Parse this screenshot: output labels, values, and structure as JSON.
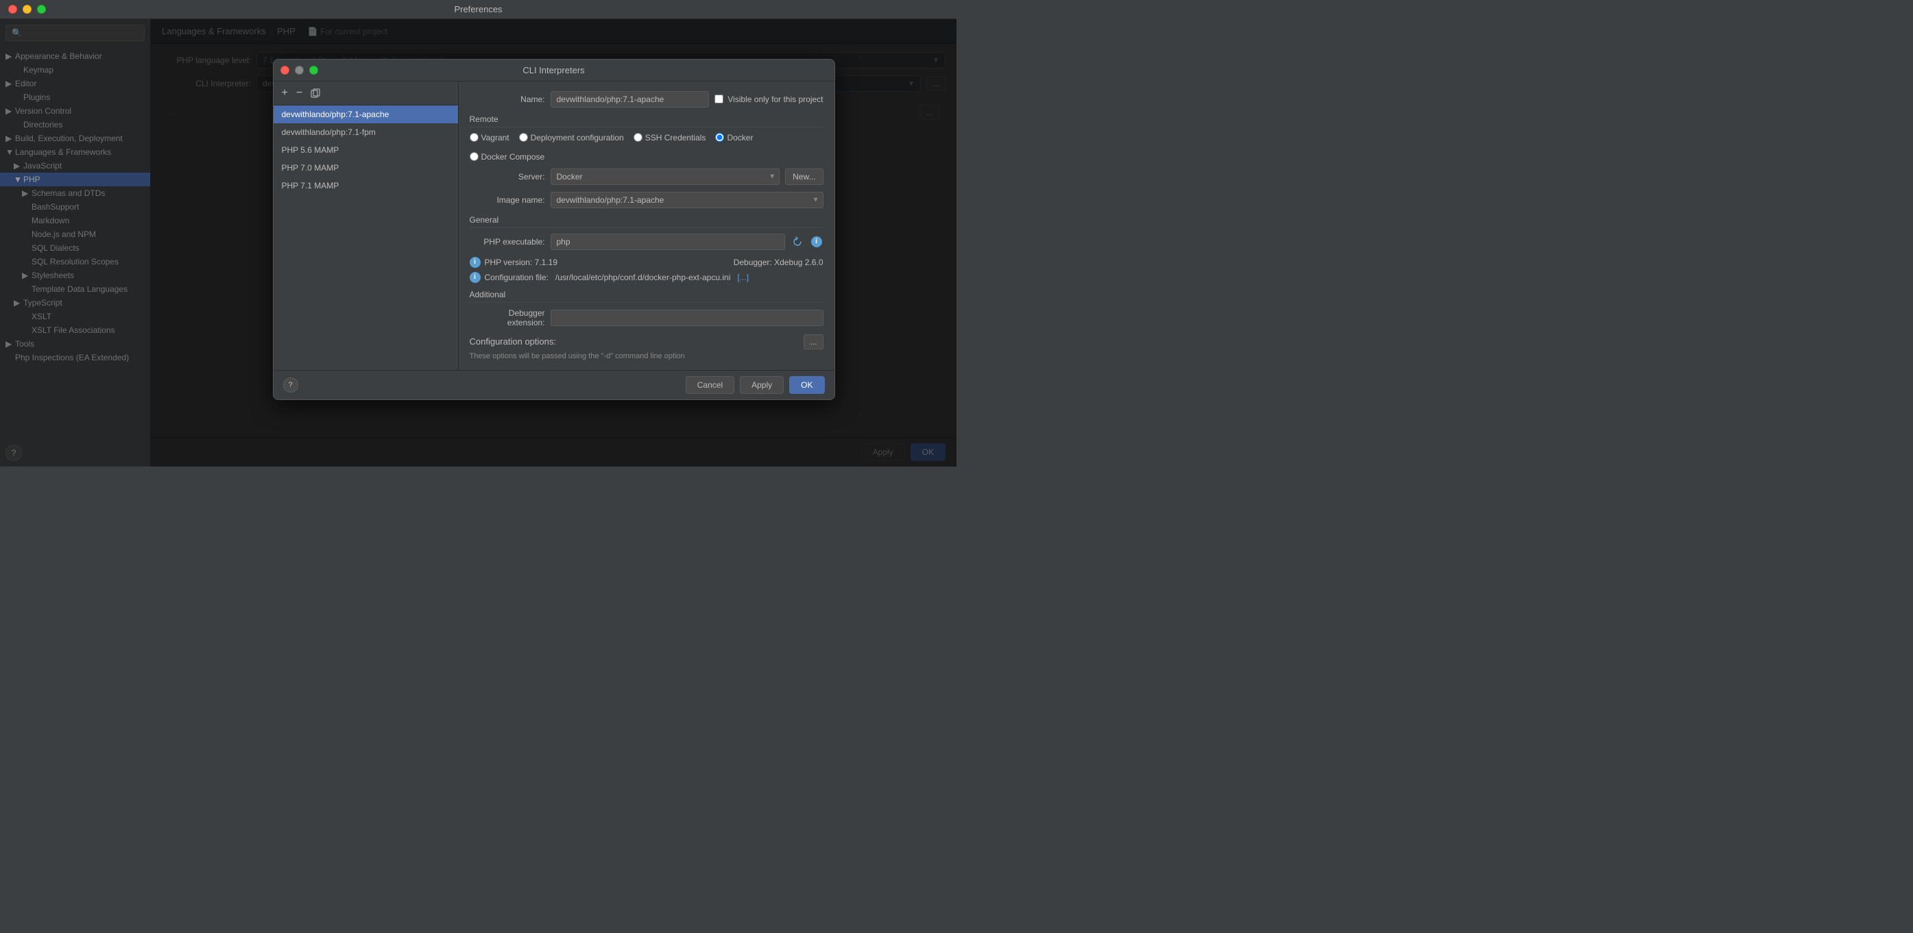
{
  "window": {
    "title": "Preferences",
    "traffic_lights": [
      "close",
      "minimize",
      "maximize"
    ]
  },
  "sidebar": {
    "search_placeholder": "",
    "items": [
      {
        "id": "appearance",
        "label": "Appearance & Behavior",
        "indent": 0,
        "has_arrow": true,
        "expanded": false
      },
      {
        "id": "keymap",
        "label": "Keymap",
        "indent": 1,
        "has_arrow": false
      },
      {
        "id": "editor",
        "label": "Editor",
        "indent": 0,
        "has_arrow": true,
        "expanded": false
      },
      {
        "id": "plugins",
        "label": "Plugins",
        "indent": 1,
        "has_arrow": false
      },
      {
        "id": "version-control",
        "label": "Version Control",
        "indent": 0,
        "has_arrow": true,
        "expanded": false
      },
      {
        "id": "directories",
        "label": "Directories",
        "indent": 1,
        "has_arrow": false
      },
      {
        "id": "build",
        "label": "Build, Execution, Deployment",
        "indent": 0,
        "has_arrow": true,
        "expanded": false
      },
      {
        "id": "languages",
        "label": "Languages & Frameworks",
        "indent": 0,
        "has_arrow": true,
        "expanded": true
      },
      {
        "id": "javascript",
        "label": "JavaScript",
        "indent": 1,
        "has_arrow": true,
        "expanded": false
      },
      {
        "id": "php",
        "label": "PHP",
        "indent": 1,
        "has_arrow": true,
        "expanded": true,
        "active": true
      },
      {
        "id": "schemas",
        "label": "Schemas and DTDs",
        "indent": 2,
        "has_arrow": true,
        "expanded": false
      },
      {
        "id": "bashsupport",
        "label": "BashSupport",
        "indent": 2,
        "has_arrow": false
      },
      {
        "id": "markdown",
        "label": "Markdown",
        "indent": 2,
        "has_arrow": false
      },
      {
        "id": "nodejs",
        "label": "Node.js and NPM",
        "indent": 2,
        "has_arrow": false
      },
      {
        "id": "sql-dialects",
        "label": "SQL Dialects",
        "indent": 2,
        "has_arrow": false
      },
      {
        "id": "sql-resolution",
        "label": "SQL Resolution Scopes",
        "indent": 2,
        "has_arrow": false
      },
      {
        "id": "stylesheets",
        "label": "Stylesheets",
        "indent": 2,
        "has_arrow": true,
        "expanded": false
      },
      {
        "id": "template-data",
        "label": "Template Data Languages",
        "indent": 2,
        "has_arrow": false
      },
      {
        "id": "typescript",
        "label": "TypeScript",
        "indent": 1,
        "has_arrow": true,
        "expanded": false
      },
      {
        "id": "xslt",
        "label": "XSLT",
        "indent": 2,
        "has_arrow": false
      },
      {
        "id": "xslt-file",
        "label": "XSLT File Associations",
        "indent": 2,
        "has_arrow": false
      },
      {
        "id": "tools",
        "label": "Tools",
        "indent": 0,
        "has_arrow": true,
        "expanded": false
      },
      {
        "id": "php-inspections",
        "label": "Php Inspections (EA Extended)",
        "indent": 0,
        "has_arrow": false
      }
    ]
  },
  "breadcrumb": {
    "parts": [
      "Languages & Frameworks",
      "PHP"
    ],
    "project_label": "For current project"
  },
  "php_settings": {
    "language_level_label": "PHP language level:",
    "language_level_value": "7.1 (const visibility, nullables, multiple exceptions)",
    "cli_interpreter_label": "CLI Interpreter:",
    "cli_interpreter_value": "devwithlando/php:7.1-apache (7.1.19)"
  },
  "dialog": {
    "title": "CLI Interpreters",
    "list": {
      "items": [
        {
          "id": "devwithlando-apache",
          "label": "devwithlando/php:7.1-apache",
          "active": true
        },
        {
          "id": "devwithlando-fpm",
          "label": "devwithlando/php:7.1-fpm"
        },
        {
          "id": "php56-mamp",
          "label": "PHP 5.6 MAMP"
        },
        {
          "id": "php70-mamp",
          "label": "PHP 7.0 MAMP"
        },
        {
          "id": "php71-mamp",
          "label": "PHP 7.1 MAMP"
        }
      ],
      "toolbar": {
        "add": "+",
        "remove": "−",
        "copy": "⧉"
      }
    },
    "detail": {
      "name_label": "Name:",
      "name_value": "devwithlando/php:7.1-apache",
      "visible_only_label": "Visible only for this project",
      "remote_section": "Remote",
      "radio_options": [
        {
          "id": "vagrant",
          "label": "Vagrant",
          "checked": false
        },
        {
          "id": "deployment",
          "label": "Deployment configuration",
          "checked": false
        },
        {
          "id": "ssh",
          "label": "SSH Credentials",
          "checked": false
        },
        {
          "id": "docker",
          "label": "Docker",
          "checked": true
        },
        {
          "id": "docker-compose",
          "label": "Docker Compose",
          "checked": false
        }
      ],
      "server_label": "Server:",
      "server_value": "Docker",
      "new_btn": "New...",
      "image_label": "Image name:",
      "image_value": "devwithlando/php:7.1-apache",
      "general_section": "General",
      "php_executable_label": "PHP executable:",
      "php_executable_value": "php",
      "php_version": "PHP version: 7.1.19",
      "debugger_label": "Debugger: Xdebug 2.6.0",
      "config_file_label": "Configuration file:",
      "config_file_path": "/usr/local/etc/php/conf.d/docker-php-ext-apcu.ini",
      "config_file_link": "[...]",
      "additional_section": "Additional",
      "debugger_ext_label": "Debugger extension:",
      "config_options_label": "Configuration options:",
      "config_hint": "These options will be passed using the \"-d\" command line option",
      "buttons": {
        "cancel": "Cancel",
        "apply": "Apply",
        "ok": "OK"
      }
    }
  },
  "bottom_bar": {
    "apply": "Apply",
    "ok": "OK"
  }
}
